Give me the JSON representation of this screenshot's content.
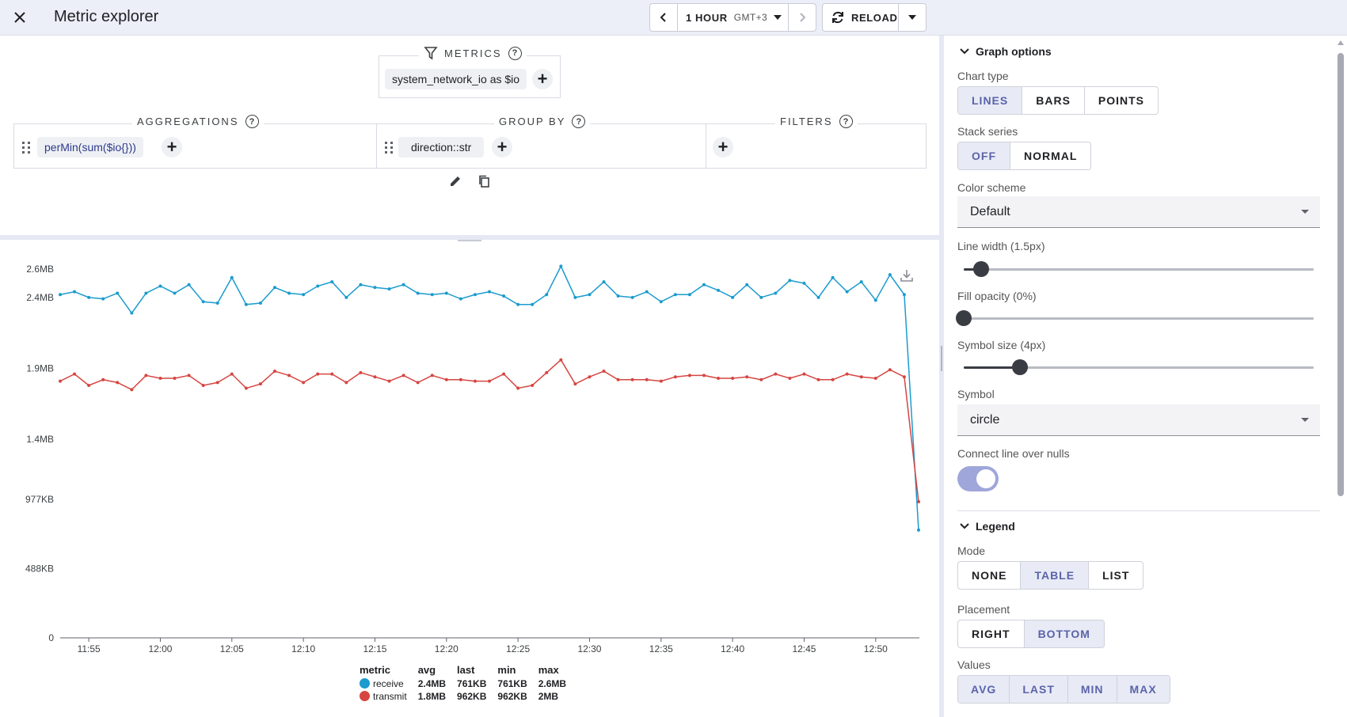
{
  "header": {
    "title": "Metric explorer",
    "time_range": "1 HOUR",
    "timezone": "GMT+3",
    "reload_label": "RELOAD"
  },
  "builder": {
    "metrics_label": "METRICS",
    "metric_chip": "system_network_io as $io",
    "aggregations_label": "AGGREGATIONS",
    "aggregation_chip_fn": "perMin",
    "aggregation_chip_rest": "(sum($io{}))",
    "group_by_label": "GROUP BY",
    "group_by_chip": "direction::str",
    "filters_label": "FILTERS"
  },
  "chart_data": {
    "type": "line",
    "y_ticks": [
      "2.6MB",
      "2.4MB",
      "1.9MB",
      "1.4MB",
      "977KB",
      "488KB",
      "0"
    ],
    "x_ticks": [
      "11:55",
      "12:00",
      "12:05",
      "12:10",
      "12:15",
      "12:20",
      "12:25",
      "12:30",
      "12:35",
      "12:40",
      "12:45",
      "12:50"
    ],
    "xlabel": "",
    "ylabel": "",
    "legend_placement": "bottom",
    "colors": {
      "receive": "#1b9bce",
      "transmit": "#d64541"
    },
    "series": [
      {
        "name": "receive",
        "unit_values_mb": [
          2.42,
          2.44,
          2.4,
          2.39,
          2.43,
          2.29,
          2.43,
          2.48,
          2.43,
          2.49,
          2.37,
          2.36,
          2.54,
          2.35,
          2.36,
          2.47,
          2.43,
          2.42,
          2.48,
          2.51,
          2.4,
          2.49,
          2.47,
          2.46,
          2.49,
          2.43,
          2.42,
          2.43,
          2.39,
          2.42,
          2.44,
          2.41,
          2.35,
          2.35,
          2.42,
          2.62,
          2.4,
          2.42,
          2.51,
          2.41,
          2.4,
          2.44,
          2.37,
          2.42,
          2.42,
          2.49,
          2.45,
          2.4,
          2.49,
          2.4,
          2.43,
          2.52,
          2.5,
          2.4,
          2.54,
          2.44,
          2.51,
          2.38,
          2.56,
          2.42,
          0.76
        ],
        "avg": "2.4MB",
        "last": "761KB",
        "min": "761KB",
        "max": "2.6MB"
      },
      {
        "name": "transmit",
        "unit_values_mb": [
          1.81,
          1.86,
          1.78,
          1.82,
          1.8,
          1.75,
          1.85,
          1.83,
          1.83,
          1.85,
          1.78,
          1.8,
          1.86,
          1.76,
          1.79,
          1.88,
          1.85,
          1.8,
          1.86,
          1.86,
          1.8,
          1.87,
          1.84,
          1.81,
          1.85,
          1.8,
          1.85,
          1.82,
          1.82,
          1.81,
          1.81,
          1.86,
          1.76,
          1.78,
          1.87,
          1.96,
          1.79,
          1.84,
          1.88,
          1.82,
          1.82,
          1.82,
          1.81,
          1.84,
          1.85,
          1.85,
          1.83,
          1.83,
          1.84,
          1.82,
          1.86,
          1.83,
          1.86,
          1.82,
          1.82,
          1.86,
          1.84,
          1.83,
          1.89,
          1.84,
          0.96
        ],
        "avg": "1.8MB",
        "last": "962KB",
        "min": "962KB",
        "max": "2MB"
      }
    ]
  },
  "legend": {
    "headers": [
      "metric",
      "avg",
      "last",
      "min",
      "max"
    ]
  },
  "panel": {
    "graph_options_label": "Graph options",
    "chart_type_label": "Chart type",
    "chart_type_options": [
      "LINES",
      "BARS",
      "POINTS"
    ],
    "chart_type_selected": "LINES",
    "stack_label": "Stack series",
    "stack_options": [
      "OFF",
      "NORMAL"
    ],
    "stack_selected": "OFF",
    "color_scheme_label": "Color scheme",
    "color_scheme_value": "Default",
    "line_width_label": "Line width (1.5px)",
    "line_width_level": 0.05,
    "fill_opacity_label": "Fill opacity (0%)",
    "fill_opacity_level": 0.0,
    "symbol_size_label": "Symbol size (4px)",
    "symbol_size_level": 0.16,
    "symbol_label": "Symbol",
    "symbol_value": "circle",
    "connect_nulls_label": "Connect line over nulls",
    "connect_nulls_on": true,
    "legend_label": "Legend",
    "mode_label": "Mode",
    "mode_options": [
      "NONE",
      "TABLE",
      "LIST"
    ],
    "mode_selected": "TABLE",
    "placement_label": "Placement",
    "placement_options": [
      "RIGHT",
      "BOTTOM"
    ],
    "placement_selected": "BOTTOM",
    "values_label": "Values",
    "values_options": [
      "AVG",
      "LAST",
      "MIN",
      "MAX"
    ]
  }
}
